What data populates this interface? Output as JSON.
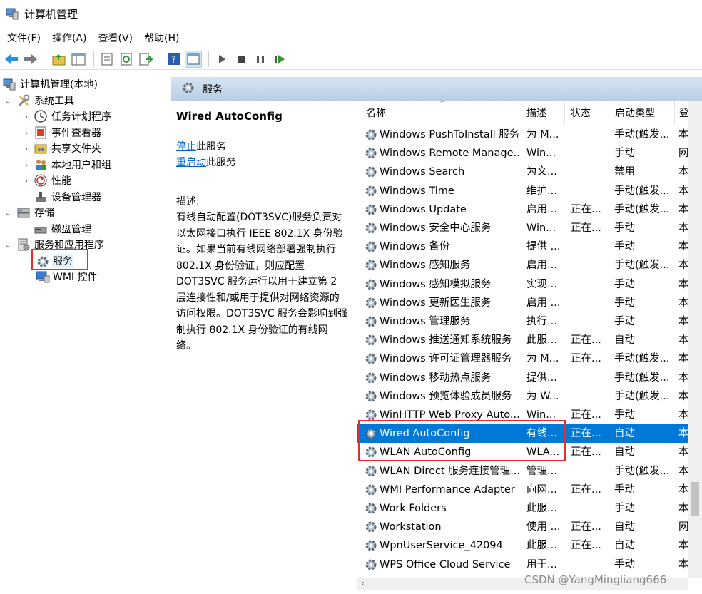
{
  "window": {
    "title": "计算机管理"
  },
  "menu": [
    "文件(F)",
    "操作(A)",
    "查看(V)",
    "帮助(H)"
  ],
  "toolbar": [
    "back-icon",
    "forward-icon",
    "up-folder-icon",
    "show-tree-icon",
    "properties-icon",
    "refresh-icon",
    "export-icon",
    "help-icon",
    "console-icon",
    "play-icon",
    "stop-icon",
    "pause-icon",
    "restart-icon"
  ],
  "tree": [
    {
      "label": "计算机管理(本地)",
      "level": 0,
      "icon": "computer-icon",
      "chevron": ""
    },
    {
      "label": "系统工具",
      "level": 1,
      "icon": "tools-icon",
      "chevron": "⌄"
    },
    {
      "label": "任务计划程序",
      "level": 2,
      "icon": "clock-icon",
      "chevron": "›"
    },
    {
      "label": "事件查看器",
      "level": 2,
      "icon": "event-log-icon",
      "chevron": "›"
    },
    {
      "label": "共享文件夹",
      "level": 2,
      "icon": "shared-folder-icon",
      "chevron": "›"
    },
    {
      "label": "本地用户和组",
      "level": 2,
      "icon": "users-icon",
      "chevron": "›"
    },
    {
      "label": "性能",
      "level": 2,
      "icon": "performance-icon",
      "chevron": "›"
    },
    {
      "label": "设备管理器",
      "level": 2,
      "icon": "device-manager-icon",
      "chevron": ""
    },
    {
      "label": "存储",
      "level": 1,
      "icon": "storage-icon",
      "chevron": "⌄"
    },
    {
      "label": "磁盘管理",
      "level": 2,
      "icon": "disk-icon",
      "chevron": ""
    },
    {
      "label": "服务和应用程序",
      "level": 1,
      "icon": "services-apps-icon",
      "chevron": "⌄"
    },
    {
      "label": "服务",
      "level": 2,
      "icon": "gear-icon",
      "chevron": ""
    },
    {
      "label": "WMI 控件",
      "level": 2,
      "icon": "wmi-icon",
      "chevron": ""
    }
  ],
  "pane": {
    "header": "服务",
    "selected_service": "Wired AutoConfig",
    "stop_link": "停止",
    "stop_suffix": "此服务",
    "restart_link": "重启动",
    "restart_suffix": "此服务",
    "desc_label": "描述:",
    "desc_text": "有线自动配置(DOT3SVC)服务负责对以太网接口执行 IEEE 802.1X 身份验证。如果当前有线网络部署强制执行 802.1X 身份验证，则应配置 DOT3SVC 服务运行以用于建立第 2 层连接性和/或用于提供对网络资源的访问权限。DOT3SVC 服务会影响到强制执行 802.1X 身份验证的有线网络。"
  },
  "columns": [
    "名称",
    "描述",
    "状态",
    "启动类型",
    "登"
  ],
  "services": [
    [
      "Windows PushToInstall 服务",
      "为 M...",
      "",
      "手动(触发...",
      "本"
    ],
    [
      "Windows Remote Manage...",
      "Win...",
      "",
      "手动",
      "网"
    ],
    [
      "Windows Search",
      "为文...",
      "",
      "禁用",
      "本"
    ],
    [
      "Windows Time",
      "维护...",
      "",
      "手动(触发...",
      "本"
    ],
    [
      "Windows Update",
      "启用...",
      "正在...",
      "手动(触发...",
      "本"
    ],
    [
      "Windows 安全中心服务",
      "Win...",
      "正在...",
      "手动",
      "本"
    ],
    [
      "Windows 备份",
      "提供 ...",
      "",
      "手动",
      "本"
    ],
    [
      "Windows 感知服务",
      "启用...",
      "",
      "手动(触发...",
      "本"
    ],
    [
      "Windows 感知模拟服务",
      "实现...",
      "",
      "手动",
      "本"
    ],
    [
      "Windows 更新医生服务",
      "启用 ...",
      "",
      "手动",
      "本"
    ],
    [
      "Windows 管理服务",
      "执行...",
      "",
      "手动",
      "本"
    ],
    [
      "Windows 推送通知系统服务",
      "此服...",
      "正在...",
      "自动",
      "本"
    ],
    [
      "Windows 许可证管理器服务",
      "为 M...",
      "正在...",
      "手动(触发...",
      "本"
    ],
    [
      "Windows 移动热点服务",
      "提供...",
      "",
      "手动(触发...",
      "本"
    ],
    [
      "Windows 预览体验成员服务",
      "为 W...",
      "",
      "手动(触发...",
      "本"
    ],
    [
      "WinHTTP Web Proxy Auto...",
      "Win...",
      "正在...",
      "手动",
      "本"
    ],
    [
      "Wired AutoConfig",
      "有线...",
      "正在...",
      "自动",
      "本"
    ],
    [
      "WLAN AutoConfig",
      "WLA...",
      "正在...",
      "自动",
      "本"
    ],
    [
      "WLAN Direct 服务连接管理...",
      "管理...",
      "",
      "手动(触发...",
      "本"
    ],
    [
      "WMI Performance Adapter",
      "向网...",
      "正在...",
      "手动",
      "本"
    ],
    [
      "Work Folders",
      "此服...",
      "",
      "手动",
      "本"
    ],
    [
      "Workstation",
      "使用 ...",
      "正在...",
      "自动",
      "网"
    ],
    [
      "WpnUserService_42094",
      "此服...",
      "正在...",
      "自动",
      "本"
    ],
    [
      "WPS Office Cloud Service",
      "用于...",
      "",
      "手动",
      "本"
    ]
  ],
  "selected_index": 16,
  "watermark": "CSDN @YangMingliang666"
}
